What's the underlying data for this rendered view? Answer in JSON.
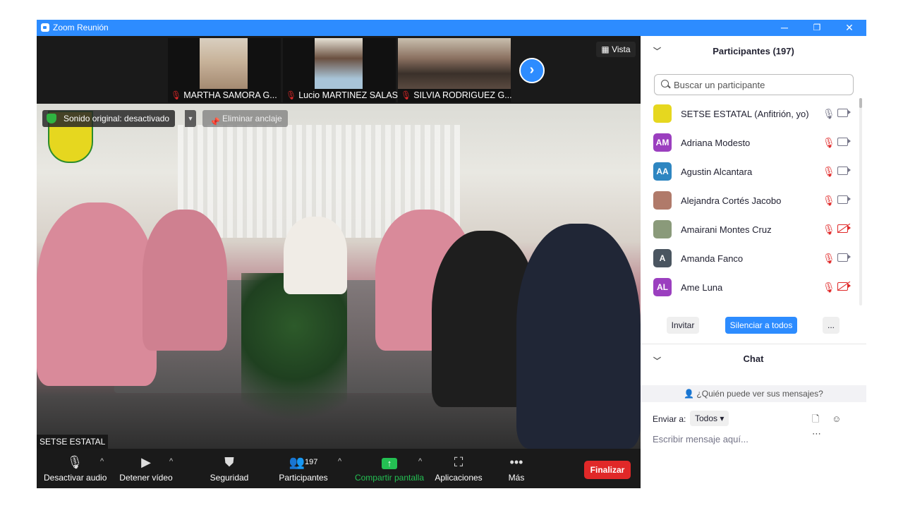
{
  "window": {
    "title": "Zoom Reunión",
    "title_color": "#2d8cff",
    "minimize": "─",
    "restore": "❐",
    "close": "✕"
  },
  "top_strip": {
    "thumbnails": [
      {
        "name": "MARTHA SAMORA G...",
        "muted": true
      },
      {
        "name": "Lucio MARTINEZ SALAS",
        "muted": true
      },
      {
        "name": "SILVIA RODRIGUEZ G...",
        "muted": true
      }
    ],
    "next_icon": "›",
    "view_button": "Vista"
  },
  "main_video": {
    "original_sound": "Sonido original: desactivado",
    "original_sound_caret": "▼",
    "unpin": "Eliminar anclaje",
    "speaker_name": "SETSE ESTATAL"
  },
  "toolbar": {
    "mute": "Desactivar audio",
    "stop_video": "Detener vídeo",
    "security": "Seguridad",
    "participants": "Participantes",
    "participants_count": "197",
    "share": "Compartir pantalla",
    "apps": "Aplicaciones",
    "more": "Más",
    "end": "Finalizar",
    "caret": "^",
    "share_color": "#24c053",
    "end_color": "#e02828"
  },
  "participants_panel": {
    "title": "Participantes (197)",
    "collapse_icon": "﹀",
    "search_placeholder": "Buscar un participante",
    "participants": [
      {
        "name": "SETSE ESTATAL (Anfitrión, yo)",
        "initials": "",
        "color": "#e6d71f",
        "mic_muted": false,
        "video_off": false
      },
      {
        "name": "Adriana Modesto",
        "initials": "AM",
        "color": "#9b3fbf",
        "mic_muted": true,
        "video_off": false
      },
      {
        "name": "Agustin Alcantara",
        "initials": "AA",
        "color": "#2e86c1",
        "mic_muted": true,
        "video_off": false
      },
      {
        "name": "Alejandra Cortés Jacobo",
        "initials": "",
        "color": "#b07a6a",
        "mic_muted": true,
        "video_off": false
      },
      {
        "name": "Amairani Montes Cruz",
        "initials": "",
        "color": "#8a9a7a",
        "mic_muted": true,
        "video_off": true
      },
      {
        "name": "Amanda Fanco",
        "initials": "A",
        "color": "#4a5560",
        "mic_muted": true,
        "video_off": false
      },
      {
        "name": "Ame Luna",
        "initials": "AL",
        "color": "#9b3fbf",
        "mic_muted": true,
        "video_off": true
      }
    ],
    "invite": "Invitar",
    "mute_all": "Silenciar a todos",
    "more": "..."
  },
  "chat_panel": {
    "title": "Chat",
    "who_can_see": "¿Quién puede ver sus mensajes?",
    "send_to_label": "Enviar a:",
    "send_to_value": "Todos",
    "message_placeholder": "Escribir mensaje aquí...",
    "icons": "🗋 ☺ ⋯"
  }
}
